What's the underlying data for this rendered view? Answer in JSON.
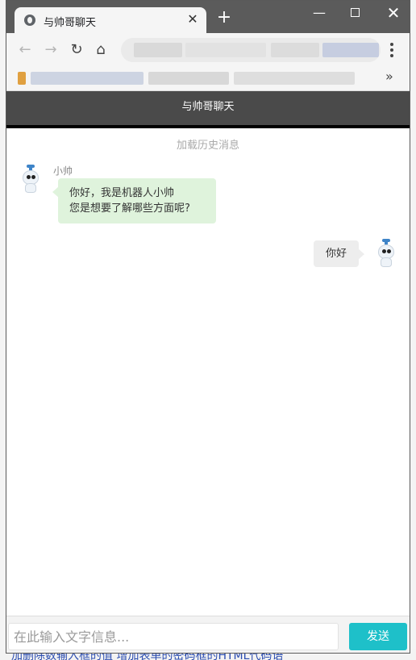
{
  "browser": {
    "tab_title": "与帅哥聊天",
    "close_tab": "✕",
    "new_tab": "+",
    "window_min": "—",
    "window_close": "✕"
  },
  "toolbar": {
    "back_icon": "←",
    "forward_icon": "→",
    "reload_icon": "↻",
    "home_icon": "⌂"
  },
  "bookmarks": {
    "more": "»"
  },
  "chat": {
    "header_title": "与帅哥聊天",
    "load_history": "加载历史消息",
    "bot": {
      "name": "小帅",
      "message_line1": "你好，我是机器人小帅",
      "message_line2": "您是想要了解哪些方面呢?"
    },
    "user": {
      "message": "你好"
    },
    "input": {
      "placeholder": "在此输入文字信息...",
      "value": ""
    },
    "send_label": "发送"
  },
  "colors": {
    "header_bg": "#4a4a4a",
    "bot_bubble": "#dff3dc",
    "user_bubble": "#ededed",
    "send_button": "#1ec0c9"
  },
  "background_page": {
    "bottom_text": "加删除数输入框的值 增加表单的密码框的HTML代码语"
  }
}
